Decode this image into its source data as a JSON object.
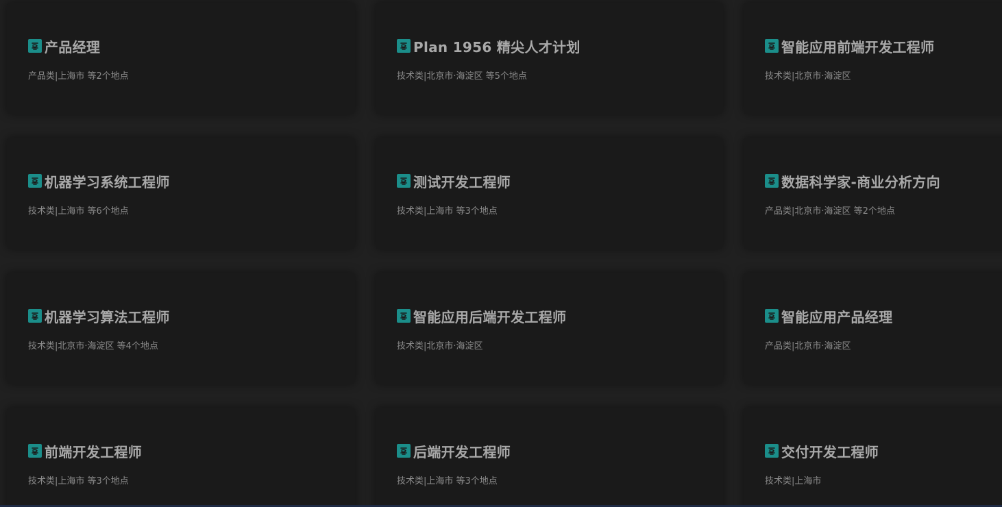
{
  "jobs": [
    {
      "title": "产品经理",
      "meta": "产品类|上海市 等2个地点"
    },
    {
      "title": "Plan 1956 精尖人才计划",
      "meta": "技术类|北京市·海淀区 等5个地点"
    },
    {
      "title": "智能应用前端开发工程师",
      "meta": "技术类|北京市·海淀区"
    },
    {
      "title": "机器学习系统工程师",
      "meta": "技术类|上海市 等6个地点"
    },
    {
      "title": "测试开发工程师",
      "meta": "技术类|上海市 等3个地点"
    },
    {
      "title": "数据科学家-商业分析方向",
      "meta": "产品类|北京市·海淀区 等2个地点"
    },
    {
      "title": "机器学习算法工程师",
      "meta": "技术类|北京市·海淀区 等4个地点"
    },
    {
      "title": "智能应用后端开发工程师",
      "meta": "技术类|北京市·海淀区"
    },
    {
      "title": "智能应用产品经理",
      "meta": "产品类|北京市·海淀区"
    },
    {
      "title": "前端开发工程师",
      "meta": "技术类|上海市 等3个地点"
    },
    {
      "title": "后端开发工程师",
      "meta": "技术类|上海市 等3个地点"
    },
    {
      "title": "交付开发工程师",
      "meta": "技术类|上海市"
    }
  ],
  "icon": {
    "name": "job-badge-icon",
    "color": "#1b8e8a"
  },
  "colors": {
    "background": "#202020",
    "card": "#1a1a1a",
    "title": "#a9a9a9",
    "meta": "#8c8c8c"
  }
}
